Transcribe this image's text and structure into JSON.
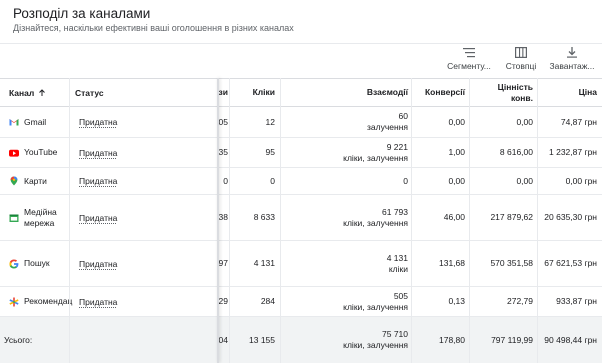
{
  "header": {
    "title": "Розподіл за каналами",
    "subtitle": "Дізнайтеся, наскільки ефективні ваші оголошення в різних каналах"
  },
  "toolbar": {
    "segment_label": "Сегменту...",
    "columns_label": "Стовпці",
    "download_label": "Завантаж..."
  },
  "table": {
    "headers": {
      "channel": "Канал",
      "status": "Статус",
      "partial": "зи",
      "clicks": "Кліки",
      "interactions": "Взаємодії",
      "conversions": "Конверсії",
      "conv_value_1": "Цінність",
      "conv_value_2": "конв.",
      "cost": "Ціна"
    },
    "rows": [
      {
        "channel": "Gmail",
        "status": "Придатна",
        "partial": "05",
        "clicks": "12",
        "inter1": "60",
        "inter2": "залучення",
        "conversions": "0,00",
        "conv_value": "0,00",
        "cost": "74,87 грн"
      },
      {
        "channel": "YouTube",
        "status": "Придатна",
        "partial": "35",
        "clicks": "95",
        "inter1": "9 221",
        "inter2": "кліки, залучення",
        "conversions": "1,00",
        "conv_value": "8 616,00",
        "cost": "1 232,87 грн"
      },
      {
        "channel": "Карти",
        "status": "Придатна",
        "partial": "0",
        "clicks": "0",
        "inter1": "0",
        "inter2": "",
        "conversions": "0,00",
        "conv_value": "0,00",
        "cost": "0,00 грн"
      },
      {
        "channel1": "Медійна",
        "channel2": "мережа",
        "status": "Придатна",
        "partial": "38",
        "clicks": "8 633",
        "inter1": "61 793",
        "inter2": "кліки, залучення",
        "conversions": "46,00",
        "conv_value": "217 879,62",
        "cost": "20 635,30 грн"
      },
      {
        "channel": "Пошук",
        "status": "Придатна",
        "partial": "97",
        "clicks": "4 131",
        "inter1": "4 131",
        "inter2": "кліки",
        "conversions": "131,68",
        "conv_value": "570 351,58",
        "cost": "67 621,53 грн"
      },
      {
        "channel": "Рекомендац",
        "status": "Придатна",
        "partial": "29",
        "clicks": "284",
        "inter1": "505",
        "inter2": "кліки, залучення",
        "conversions": "0,13",
        "conv_value": "272,79",
        "cost": "933,87 грн"
      }
    ],
    "total": {
      "label": "Усього:",
      "partial": "04",
      "clicks": "13 155",
      "inter1": "75 710",
      "inter2": "кліки, залучення",
      "conversions": "178,80",
      "conv_value": "797 119,99",
      "cost": "90 498,44 грн"
    }
  }
}
